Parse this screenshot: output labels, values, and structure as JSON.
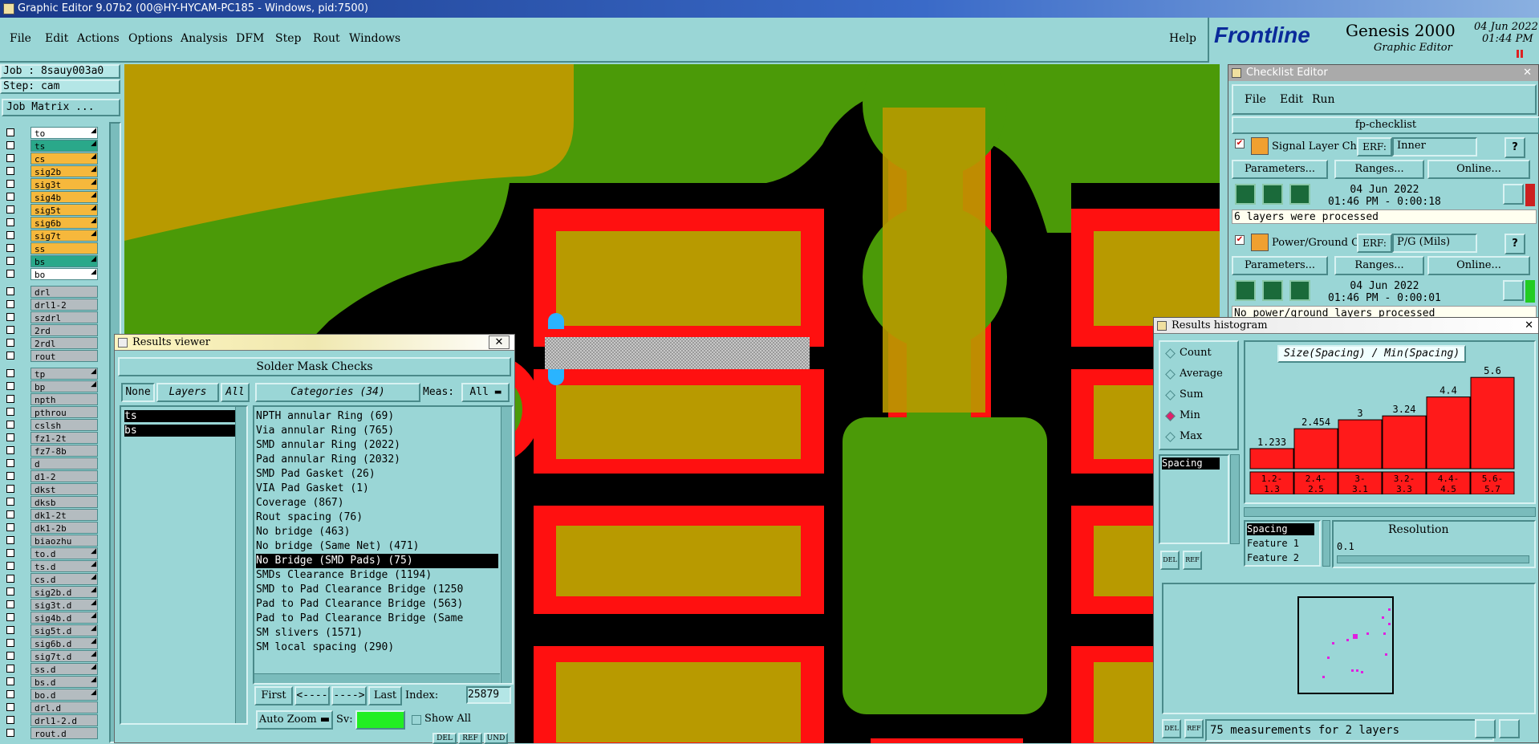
{
  "window": {
    "title": "Graphic Editor 9.07b2 (00@HY-HYCAM-PC185 - Windows, pid:7500)"
  },
  "menu": {
    "items": [
      "File",
      "Edit",
      "Actions",
      "Options",
      "Analysis",
      "DFM",
      "Step",
      "Rout",
      "Windows"
    ],
    "help": "Help"
  },
  "logo": {
    "brand": "Frontline",
    "product": "Genesis 2000",
    "subtitle": "Graphic Editor",
    "date": "04 Jun 2022",
    "time": "01:44 PM"
  },
  "job": {
    "job_label": "Job : 8sauy003a0",
    "step_label": "Step: cam",
    "matrix_button": "Job Matrix ..."
  },
  "layers": [
    {
      "name": "to",
      "color": "#ffffff",
      "arrow": true
    },
    {
      "name": "ts",
      "color": "#2aa88a",
      "arrow": true
    },
    {
      "name": "cs",
      "color": "#f6b83c",
      "arrow": true
    },
    {
      "name": "sig2b",
      "color": "#f6b83c",
      "arrow": true
    },
    {
      "name": "sig3t",
      "color": "#f6b83c",
      "arrow": true
    },
    {
      "name": "sig4b",
      "color": "#f6b83c",
      "arrow": true
    },
    {
      "name": "sig5t",
      "color": "#f6b83c",
      "arrow": true
    },
    {
      "name": "sig6b",
      "color": "#f6b83c",
      "arrow": true
    },
    {
      "name": "sig7t",
      "color": "#f6b83c",
      "arrow": true
    },
    {
      "name": "ss",
      "color": "#f6b83c",
      "arrow": false
    },
    {
      "name": "bs",
      "color": "#2aa88a",
      "arrow": true
    },
    {
      "name": "bo",
      "color": "#ffffff",
      "arrow": true
    },
    {
      "name": "drl",
      "color": "#b4bcc0",
      "arrow": false
    },
    {
      "name": "drl1-2",
      "color": "#b4bcc0",
      "arrow": false
    },
    {
      "name": "szdrl",
      "color": "#b4bcc0",
      "arrow": false
    },
    {
      "name": "2rd",
      "color": "#b4bcc0",
      "arrow": false
    },
    {
      "name": "2rdl",
      "color": "#b4bcc0",
      "arrow": false
    },
    {
      "name": "rout",
      "color": "#b4bcc0",
      "arrow": false
    },
    {
      "name": "tp",
      "color": "#b4bcc0",
      "arrow": true
    },
    {
      "name": "bp",
      "color": "#b4bcc0",
      "arrow": true
    },
    {
      "name": "npth",
      "color": "#b4bcc0",
      "arrow": false
    },
    {
      "name": "pthrou",
      "color": "#b4bcc0",
      "arrow": false
    },
    {
      "name": "cslsh",
      "color": "#b4bcc0",
      "arrow": false
    },
    {
      "name": "fz1-2t",
      "color": "#b4bcc0",
      "arrow": false
    },
    {
      "name": "fz7-8b",
      "color": "#b4bcc0",
      "arrow": false
    },
    {
      "name": "d",
      "color": "#b4bcc0",
      "arrow": false
    },
    {
      "name": "d1-2",
      "color": "#b4bcc0",
      "arrow": false
    },
    {
      "name": "dkst",
      "color": "#b4bcc0",
      "arrow": false
    },
    {
      "name": "dksb",
      "color": "#b4bcc0",
      "arrow": false
    },
    {
      "name": "dk1-2t",
      "color": "#b4bcc0",
      "arrow": false
    },
    {
      "name": "dk1-2b",
      "color": "#b4bcc0",
      "arrow": false
    },
    {
      "name": "biaozhu",
      "color": "#b4bcc0",
      "arrow": false
    },
    {
      "name": "to.d",
      "color": "#b4bcc0",
      "arrow": true
    },
    {
      "name": "ts.d",
      "color": "#b4bcc0",
      "arrow": true
    },
    {
      "name": "cs.d",
      "color": "#b4bcc0",
      "arrow": true
    },
    {
      "name": "sig2b.d",
      "color": "#b4bcc0",
      "arrow": true
    },
    {
      "name": "sig3t.d",
      "color": "#b4bcc0",
      "arrow": true
    },
    {
      "name": "sig4b.d",
      "color": "#b4bcc0",
      "arrow": true
    },
    {
      "name": "sig5t.d",
      "color": "#b4bcc0",
      "arrow": true
    },
    {
      "name": "sig6b.d",
      "color": "#b4bcc0",
      "arrow": true
    },
    {
      "name": "sig7t.d",
      "color": "#b4bcc0",
      "arrow": true
    },
    {
      "name": "ss.d",
      "color": "#b4bcc0",
      "arrow": true
    },
    {
      "name": "bs.d",
      "color": "#b4bcc0",
      "arrow": true
    },
    {
      "name": "bo.d",
      "color": "#b4bcc0",
      "arrow": true
    },
    {
      "name": "drl.d",
      "color": "#b4bcc0",
      "arrow": false
    },
    {
      "name": "drl1-2.d",
      "color": "#b4bcc0",
      "arrow": false
    },
    {
      "name": "rout.d",
      "color": "#b4bcc0",
      "arrow": false
    }
  ],
  "results_viewer": {
    "title": "Results viewer",
    "header": "Solder Mask Checks",
    "none_btn": "None",
    "layers_btn": "Layers",
    "all_btn": "All",
    "categories_btn": "Categories (34)",
    "meas_label": "Meas:",
    "meas_value": "All",
    "layer_list": [
      "ts",
      "bs"
    ],
    "categories": [
      "NPTH annular Ring (69)",
      "Via annular Ring (765)",
      "SMD annular Ring (2022)",
      "Pad annular Ring (2032)",
      "SMD Pad Gasket (26)",
      "VIA Pad Gasket (1)",
      "Coverage (867)",
      "Rout spacing (76)",
      "No bridge (463)",
      "No bridge (Same Net) (471)",
      "No Bridge (SMD Pads) (75)",
      "SMDs Clearance Bridge (1194)",
      "SMD to Pad Clearance Bridge (1250",
      "Pad to Pad Clearance Bridge (563)",
      "Pad to Pad Clearance Bridge (Same",
      "SM slivers (1571)",
      "SM local spacing (290)"
    ],
    "selected_index": 10,
    "first_btn": "First",
    "prev_btn": "<----",
    "next_btn": "---->",
    "last_btn": "Last",
    "index_label": "Index:",
    "index_value": "25879",
    "autozoom": "Auto Zoom",
    "sv_label": "Sv:",
    "show_all": "Show All",
    "del": "DEL",
    "ref": "REF",
    "und": "UND"
  },
  "checklist": {
    "title": "Checklist Editor",
    "menu": [
      "File",
      "Edit",
      "Run"
    ],
    "name": "fp-checklist",
    "items": [
      {
        "name": "Signal Layer Ch",
        "erf_label": "ERF:",
        "erf": "Inner",
        "params": "Parameters...",
        "ranges": "Ranges...",
        "online": "Online...",
        "date": "04 Jun 2022",
        "time": "01:46 PM - 0:00:18",
        "status": "6 layers were processed",
        "status_color": "#cc2020"
      },
      {
        "name": "Power/Ground C",
        "erf_label": "ERF:",
        "erf": "P/G (Mils)",
        "params": "Parameters...",
        "ranges": "Ranges...",
        "online": "Online...",
        "date": "04 Jun 2022",
        "time": "01:46 PM - 0:00:01",
        "status": "No power/ground layers processed",
        "status_color": "#22cc22"
      }
    ]
  },
  "histogram": {
    "title": "Results histogram",
    "modes": [
      "Count",
      "Average",
      "Sum",
      "Min",
      "Max"
    ],
    "selected_mode": "Min",
    "list_item": "Spacing",
    "chart_title": "Size(Spacing) / Min(Spacing)",
    "resolution_label": "Resolution",
    "resolution": "0.1",
    "feature_list": [
      "Spacing",
      "Feature 1",
      "Feature 2"
    ],
    "status": "75 measurements for 2 layers",
    "del": "DEL",
    "ref": "REF"
  },
  "chart_data": {
    "type": "bar",
    "title": "Size(Spacing) / Min(Spacing)",
    "categories": [
      "1.2-1.3",
      "2.4-2.5",
      "3-3.1",
      "3.2-3.3",
      "4.4-4.5",
      "5.6-5.7"
    ],
    "values": [
      1.233,
      2.454,
      3,
      3.24,
      4.4,
      5.6
    ],
    "value_labels": [
      "1.233",
      "2.454",
      "3",
      "3.24",
      "4.4",
      "5.6"
    ],
    "ylim": [
      0,
      6.3
    ],
    "bar_color": "#ff1a1a"
  }
}
